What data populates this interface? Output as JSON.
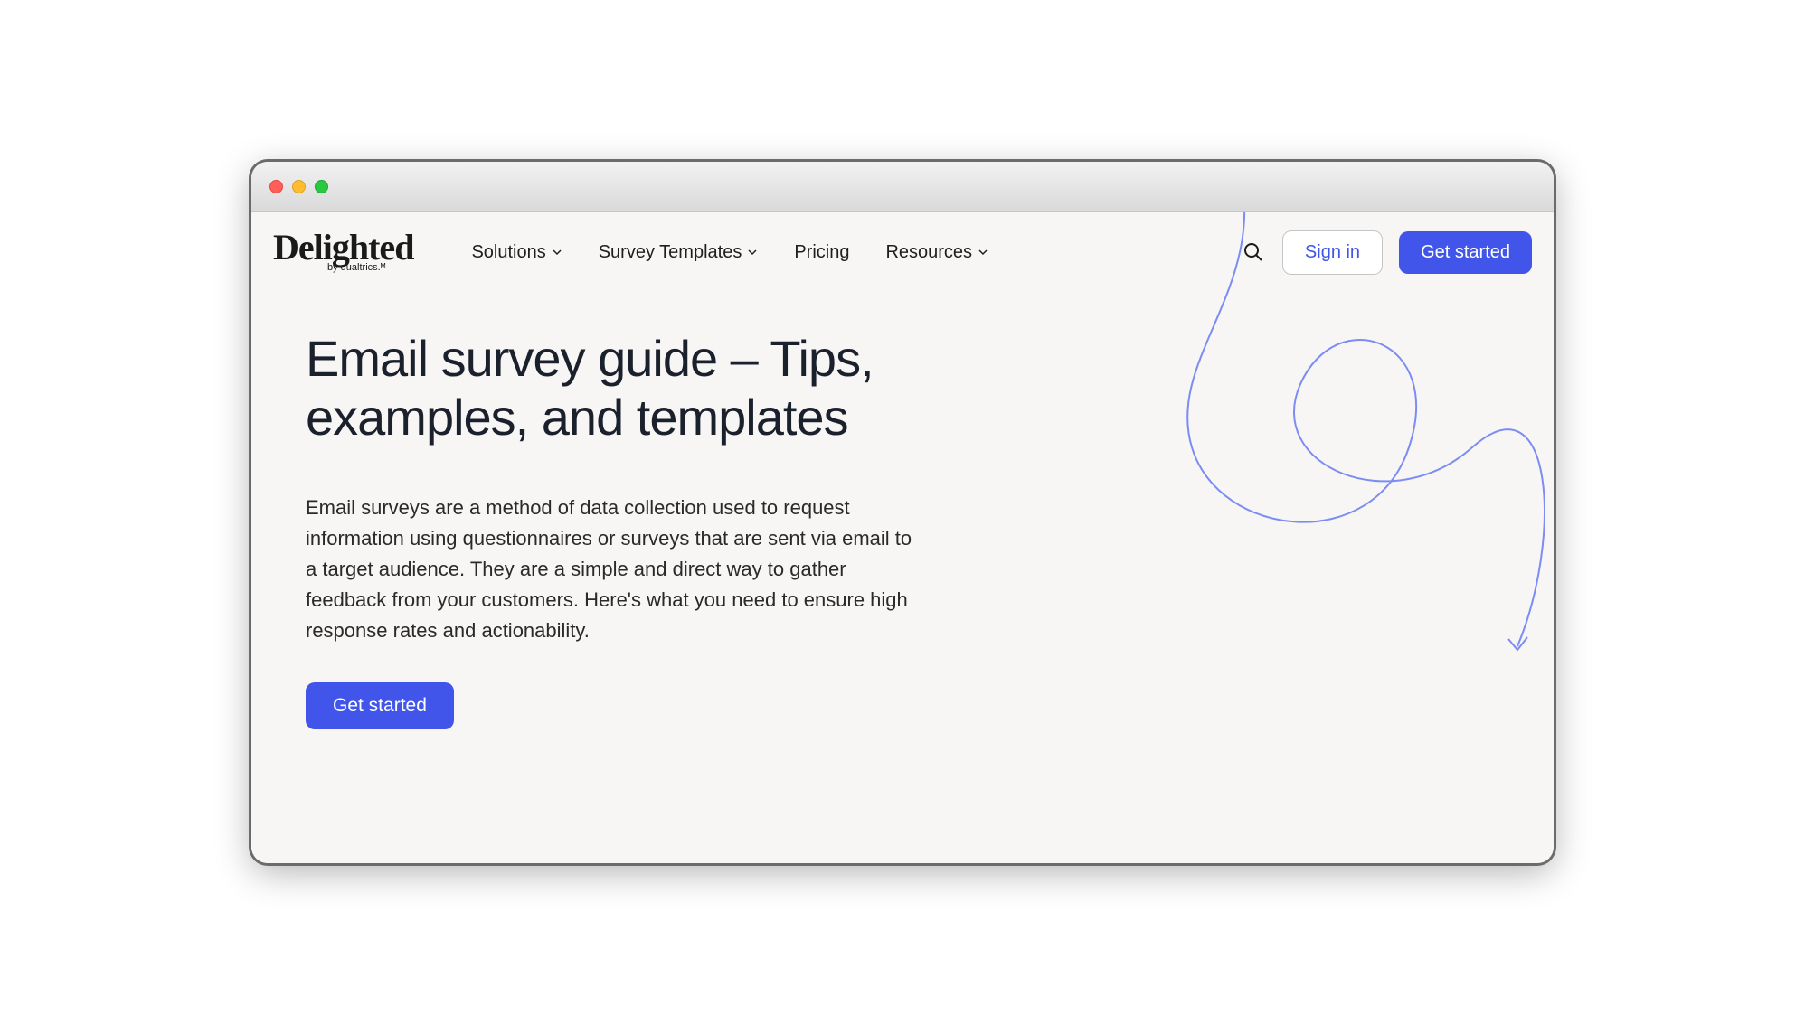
{
  "logo": {
    "main": "Delighted",
    "sub": "by qualtrics.ᴹ"
  },
  "nav": {
    "items": [
      {
        "label": "Solutions",
        "has_dropdown": true
      },
      {
        "label": "Survey Templates",
        "has_dropdown": true
      },
      {
        "label": "Pricing",
        "has_dropdown": false
      },
      {
        "label": "Resources",
        "has_dropdown": true
      }
    ],
    "signin": "Sign in",
    "getstarted": "Get started"
  },
  "hero": {
    "title": "Email survey guide – Tips, examples, and templates",
    "body": "Email surveys are a method of data collection used to request information using questionnaires or surveys that are sent via email to a target audience. They are a simple and direct way to gather feedback from your customers. Here's what you need to ensure high response rates and actionability.",
    "cta": "Get started"
  }
}
